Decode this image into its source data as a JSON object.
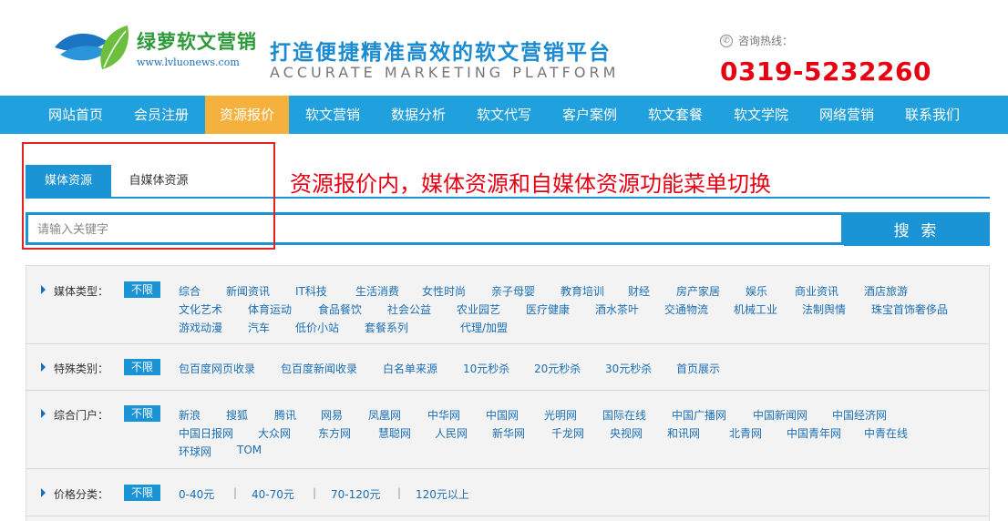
{
  "header": {
    "logo_text": "绿萝软文营销",
    "logo_url": "www.lvluonews.com",
    "slogan": "打造便捷精准高效的软文营销平台",
    "slogan_en": "ACCURATE MARKETING PLATFORM",
    "hotline_label": "咨询热线：",
    "hotline_number": "0319-5232260"
  },
  "nav": {
    "items": [
      "网站首页",
      "会员注册",
      "资源报价",
      "软文营销",
      "数据分析",
      "软文代写",
      "客户案例",
      "软文套餐",
      "软文学院",
      "网络营销",
      "联系我们"
    ],
    "active_index": 2
  },
  "tabs": {
    "media": "媒体资源",
    "self_media": "自媒体资源"
  },
  "annotation": "资源报价内，媒体资源和自媒体资源功能菜单切换",
  "search": {
    "placeholder": "请输入关键字",
    "button": "搜 索"
  },
  "filters": {
    "unlimited": "不限",
    "rows": [
      {
        "label": "媒体类型：",
        "items": [
          "综合",
          "新闻资讯",
          "IT科技",
          "生活消费",
          "女性时尚",
          "亲子母婴",
          "教育培训",
          "财经",
          "房产家居",
          "娱乐",
          "商业资讯",
          "酒店旅游",
          "文化艺术",
          "体育运动",
          "食品餐饮",
          "社会公益",
          "农业园艺",
          "医疗健康",
          "酒水茶叶",
          "交通物流",
          "机械工业",
          "法制舆情",
          "珠宝首饰奢侈品",
          "游戏动漫",
          "汽车",
          "低价小站",
          "套餐系列",
          "代理/加盟"
        ]
      },
      {
        "label": "特殊类别：",
        "items": [
          "包百度网页收录",
          "包百度新闻收录",
          "白名单来源",
          "10元秒杀",
          "20元秒杀",
          "30元秒杀",
          "首页展示"
        ]
      },
      {
        "label": "综合门户：",
        "items": [
          "新浪",
          "搜狐",
          "腾讯",
          "网易",
          "凤凰网",
          "中华网",
          "中国网",
          "光明网",
          "国际在线",
          "中国广播网",
          "中国新闻网",
          "中国经济网",
          "中国日报网",
          "大众网",
          "东方网",
          "慧聪网",
          "人民网",
          "新华网",
          "千龙网",
          "央视网",
          "和讯网",
          "北青网",
          "中国青年网",
          "中青在线",
          "环球网",
          "TOM"
        ]
      },
      {
        "label": "价格分类：",
        "items": [
          "0-40元",
          "40-70元",
          "70-120元",
          "120元以上"
        ]
      }
    ]
  },
  "colors": {
    "nav_bg": "#20a0dd",
    "nav_active": "#f5b13d",
    "accent": "#1b94d6",
    "hotline": "#e60012",
    "annotation": "#e60012"
  }
}
